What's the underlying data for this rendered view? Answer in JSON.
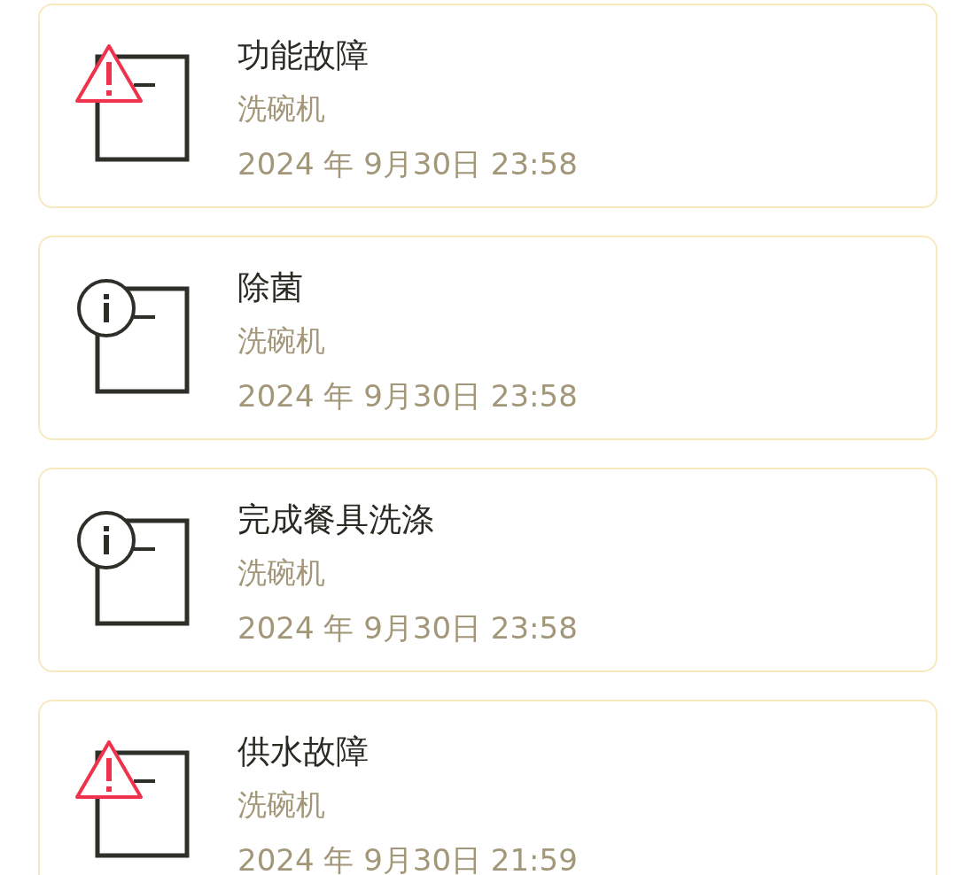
{
  "notifications": [
    {
      "kind": "alert",
      "title": "功能故障",
      "device": "洗碗机",
      "time": "2024 年 9月30日 23:58"
    },
    {
      "kind": "info",
      "title": "除菌",
      "device": "洗碗机",
      "time": "2024 年 9月30日 23:58"
    },
    {
      "kind": "info",
      "title": "完成餐具洗涤",
      "device": "洗碗机",
      "time": "2024 年 9月30日 23:58"
    },
    {
      "kind": "alert",
      "title": "供水故障",
      "device": "洗碗机",
      "time": "2024 年 9月30日 21:59"
    }
  ]
}
